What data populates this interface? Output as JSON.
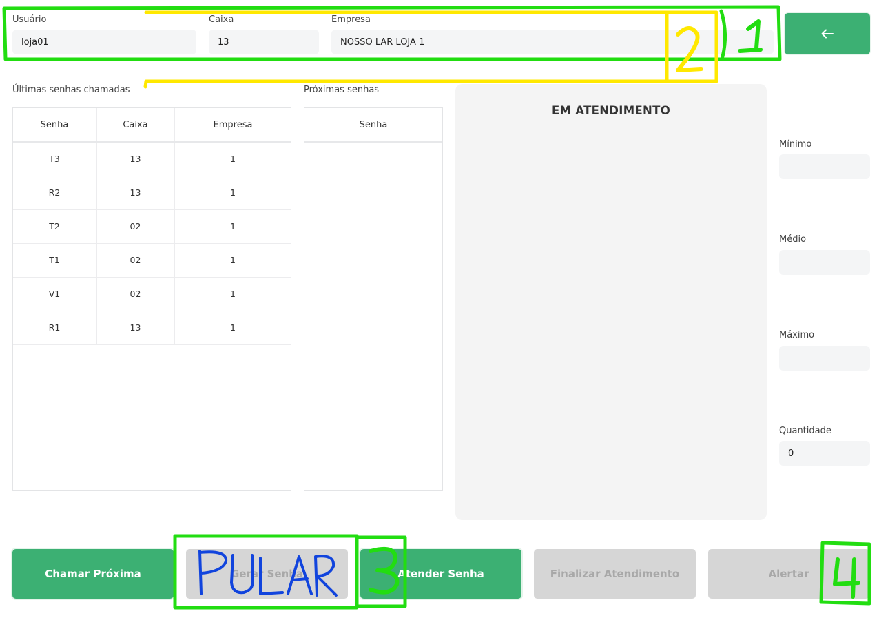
{
  "header": {
    "user_label": "Usuário",
    "user_value": "loja01",
    "cashier_label": "Caixa",
    "cashier_value": "13",
    "company_label": "Empresa",
    "company_value": "NOSSO LAR LOJA 1",
    "back_icon": "arrow-left-icon"
  },
  "recent": {
    "label": "Últimas senhas chamadas",
    "columns": [
      "Senha",
      "Caixa",
      "Empresa"
    ],
    "rows": [
      [
        "T3",
        "13",
        "1"
      ],
      [
        "R2",
        "13",
        "1"
      ],
      [
        "T2",
        "02",
        "1"
      ],
      [
        "T1",
        "02",
        "1"
      ],
      [
        "V1",
        "02",
        "1"
      ],
      [
        "R1",
        "13",
        "1"
      ]
    ]
  },
  "next": {
    "label": "Próximas senhas",
    "columns": [
      "Senha"
    ]
  },
  "attending": {
    "title": "EM ATENDIMENTO"
  },
  "stats": {
    "min_label": "Mínimo",
    "min_value": "",
    "avg_label": "Médio",
    "avg_value": "",
    "max_label": "Máximo",
    "max_value": "",
    "qty_label": "Quantidade",
    "qty_value": "0"
  },
  "actions": {
    "call_next": "Chamar Próxima",
    "generate": "Gerar Senha",
    "attend": "Atender Senha",
    "finish": "Finalizar Atendimento",
    "alert": "Alertar"
  },
  "annotations": {
    "marker_1": "1",
    "marker_2": "2",
    "marker_3": "3",
    "marker_4": "4",
    "handwritten_note": "PULAR",
    "green": "#22dd11",
    "yellow": "#ffe800",
    "blue": "#1144dd"
  }
}
